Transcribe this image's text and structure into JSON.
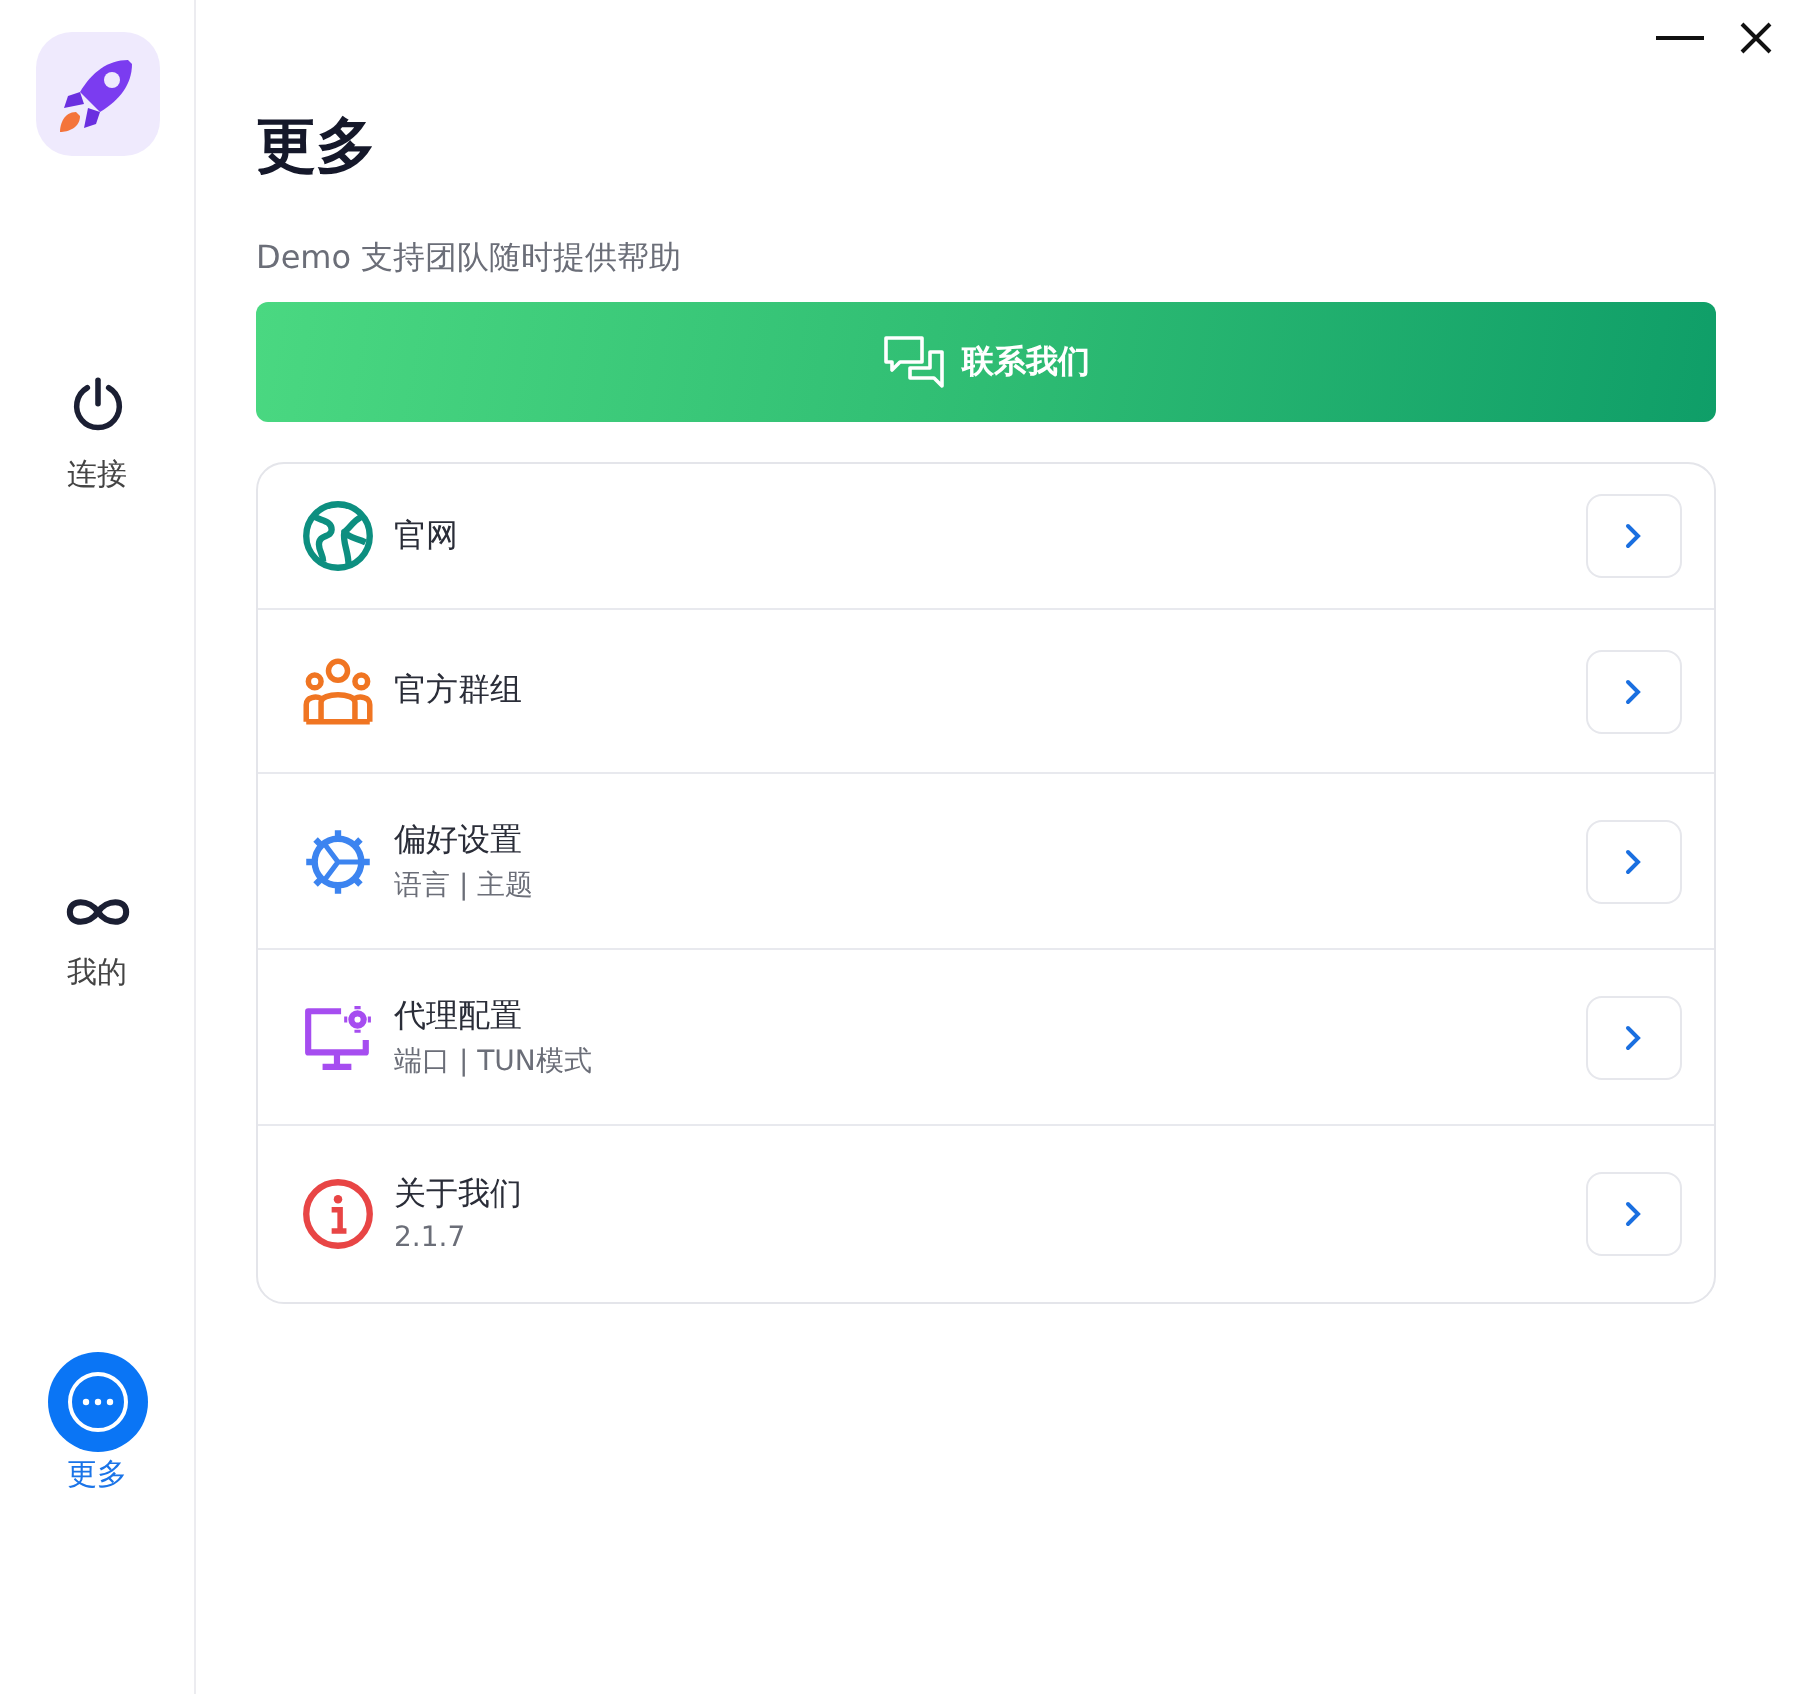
{
  "nav": [
    {
      "kind": "power",
      "label": "连接",
      "selected": false
    },
    {
      "kind": "infinity",
      "label": "我的",
      "selected": false
    },
    {
      "kind": "more",
      "label": "更多",
      "selected": true
    }
  ],
  "page": {
    "title": "更多",
    "subtitle": "Demo 支持团队随时提供帮助"
  },
  "contact_button": {
    "label": "联系我们"
  },
  "items": [
    {
      "kind": "globe",
      "title": "官网"
    },
    {
      "kind": "group",
      "title": "官方群组"
    },
    {
      "kind": "gear",
      "title": "偏好设置",
      "subtitle": "语言 | 主题"
    },
    {
      "kind": "monitor",
      "title": "代理配置",
      "subtitle": "端口 | TUN模式"
    },
    {
      "kind": "info",
      "title": "关于我们",
      "subtitle": "2.1.7"
    }
  ]
}
